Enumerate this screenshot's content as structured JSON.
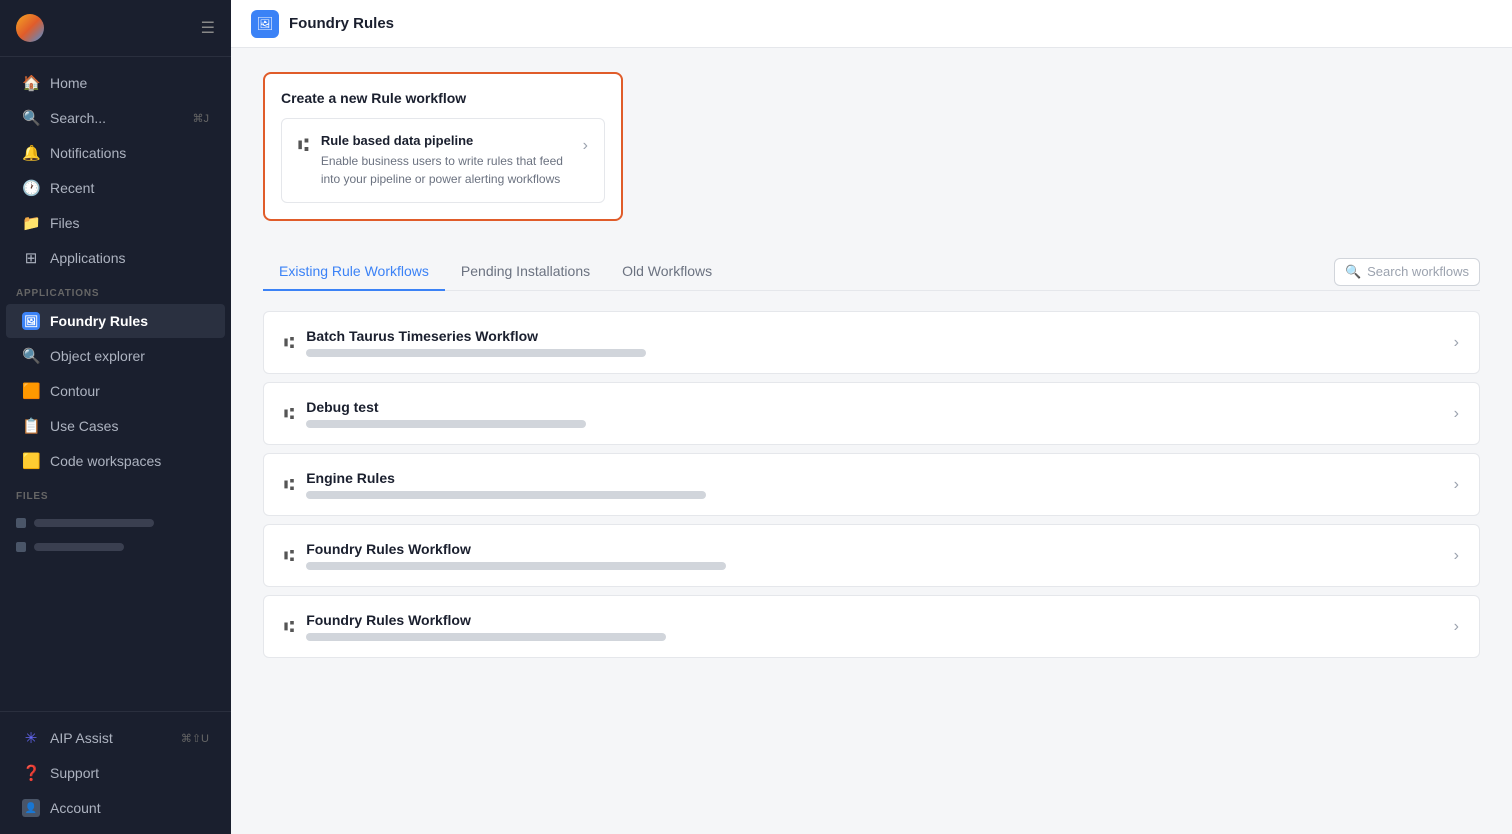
{
  "sidebar": {
    "nav": [
      {
        "id": "home",
        "label": "Home",
        "icon": "🏠"
      },
      {
        "id": "search",
        "label": "Search...",
        "icon": "🔍",
        "shortcut": "⌘J"
      },
      {
        "id": "notifications",
        "label": "Notifications",
        "icon": "🔔"
      },
      {
        "id": "recent",
        "label": "Recent",
        "icon": "🕐"
      },
      {
        "id": "files",
        "label": "Files",
        "icon": "📁"
      },
      {
        "id": "applications",
        "label": "Applications",
        "icon": "⊞"
      }
    ],
    "section_applications": "APPLICATIONS",
    "apps": [
      {
        "id": "foundry-rules",
        "label": "Foundry Rules",
        "active": true
      },
      {
        "id": "object-explorer",
        "label": "Object explorer"
      },
      {
        "id": "contour",
        "label": "Contour"
      },
      {
        "id": "use-cases",
        "label": "Use Cases"
      },
      {
        "id": "code-workspaces",
        "label": "Code workspaces"
      }
    ],
    "section_files": "FILES",
    "bottom_nav": [
      {
        "id": "aip-assist",
        "label": "AIP Assist",
        "shortcut": "⌘⇧U"
      },
      {
        "id": "support",
        "label": "Support"
      },
      {
        "id": "account",
        "label": "Account"
      }
    ]
  },
  "topbar": {
    "title": "Foundry Rules"
  },
  "create_section": {
    "title": "Create a new Rule workflow",
    "pipeline_name": "Rule based data pipeline",
    "pipeline_desc": "Enable business users to write rules that feed into your pipeline or power alerting workflows"
  },
  "tabs": {
    "items": [
      {
        "id": "existing",
        "label": "Existing Rule Workflows",
        "active": true
      },
      {
        "id": "pending",
        "label": "Pending Installations",
        "active": false
      },
      {
        "id": "old",
        "label": "Old Workflows",
        "active": false
      }
    ],
    "search_placeholder": "Search workflows"
  },
  "workflows": [
    {
      "id": "wf1",
      "name": "Batch Taurus Timeseries Workflow"
    },
    {
      "id": "wf2",
      "name": "Debug test"
    },
    {
      "id": "wf3",
      "name": "Engine Rules"
    },
    {
      "id": "wf4",
      "name": "Foundry Rules Workflow"
    },
    {
      "id": "wf5",
      "name": "Foundry Rules Workflow"
    }
  ]
}
